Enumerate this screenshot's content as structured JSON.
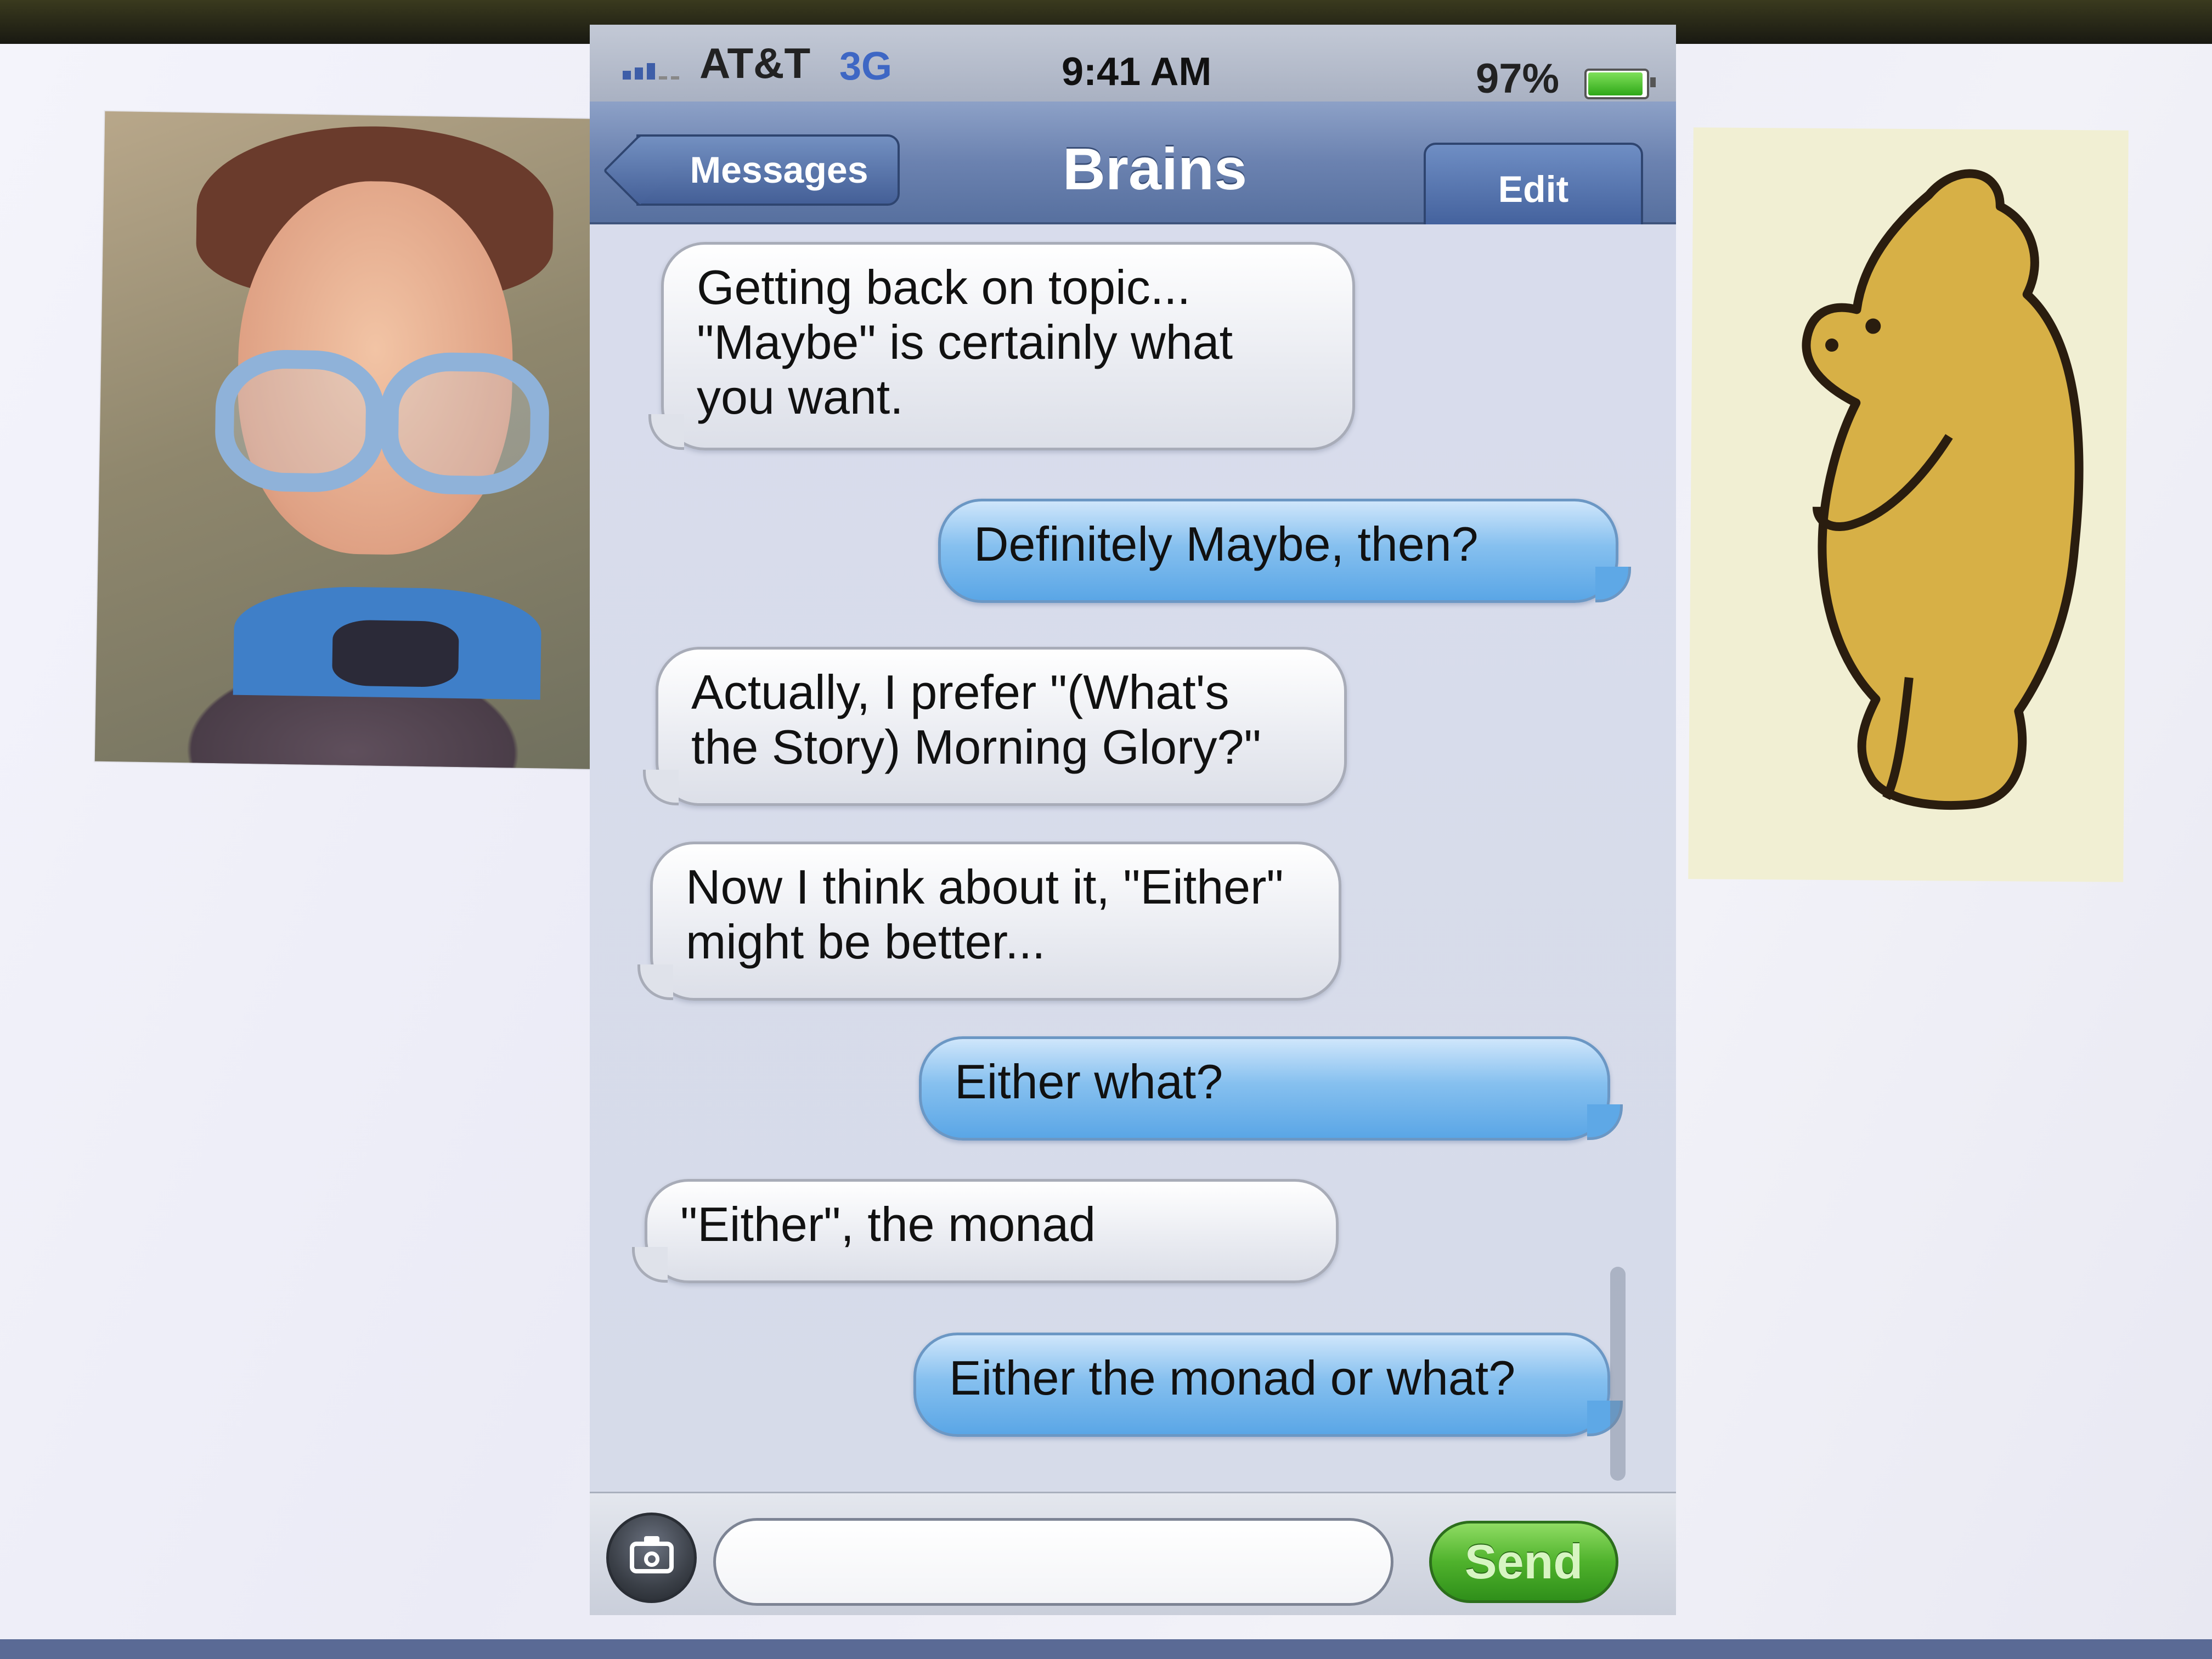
{
  "status_bar": {
    "carrier": "AT&T",
    "network": "3G",
    "time": "9:41 AM",
    "battery": "97%",
    "signal_icon": "signal-bars-icon",
    "battery_icon": "battery-icon"
  },
  "nav": {
    "back_label": "Messages",
    "title": "Brains",
    "edit_label": "Edit"
  },
  "messages": [
    {
      "direction": "in",
      "text": "Getting back on topic...\n\"Maybe\" is certainly what\nyou want."
    },
    {
      "direction": "out",
      "text": "Definitely Maybe, then?"
    },
    {
      "direction": "in",
      "text": "Actually, I prefer \"(What's\nthe Story) Morning Glory?\""
    },
    {
      "direction": "in",
      "text": "Now I think about it, \"Either\"\nmight be better..."
    },
    {
      "direction": "out",
      "text": "Either what?"
    },
    {
      "direction": "in",
      "text": "\"Either\", the monad"
    },
    {
      "direction": "out",
      "text": "Either the monad or what?"
    }
  ],
  "composer": {
    "input_value": "",
    "send_label": "Send",
    "camera_icon": "camera-icon"
  },
  "colors": {
    "nav_bar": "#6b82b0",
    "outgoing_bubble": "#86c0ef",
    "incoming_bubble": "#e9ebf1",
    "send_button": "#4fb22c"
  }
}
